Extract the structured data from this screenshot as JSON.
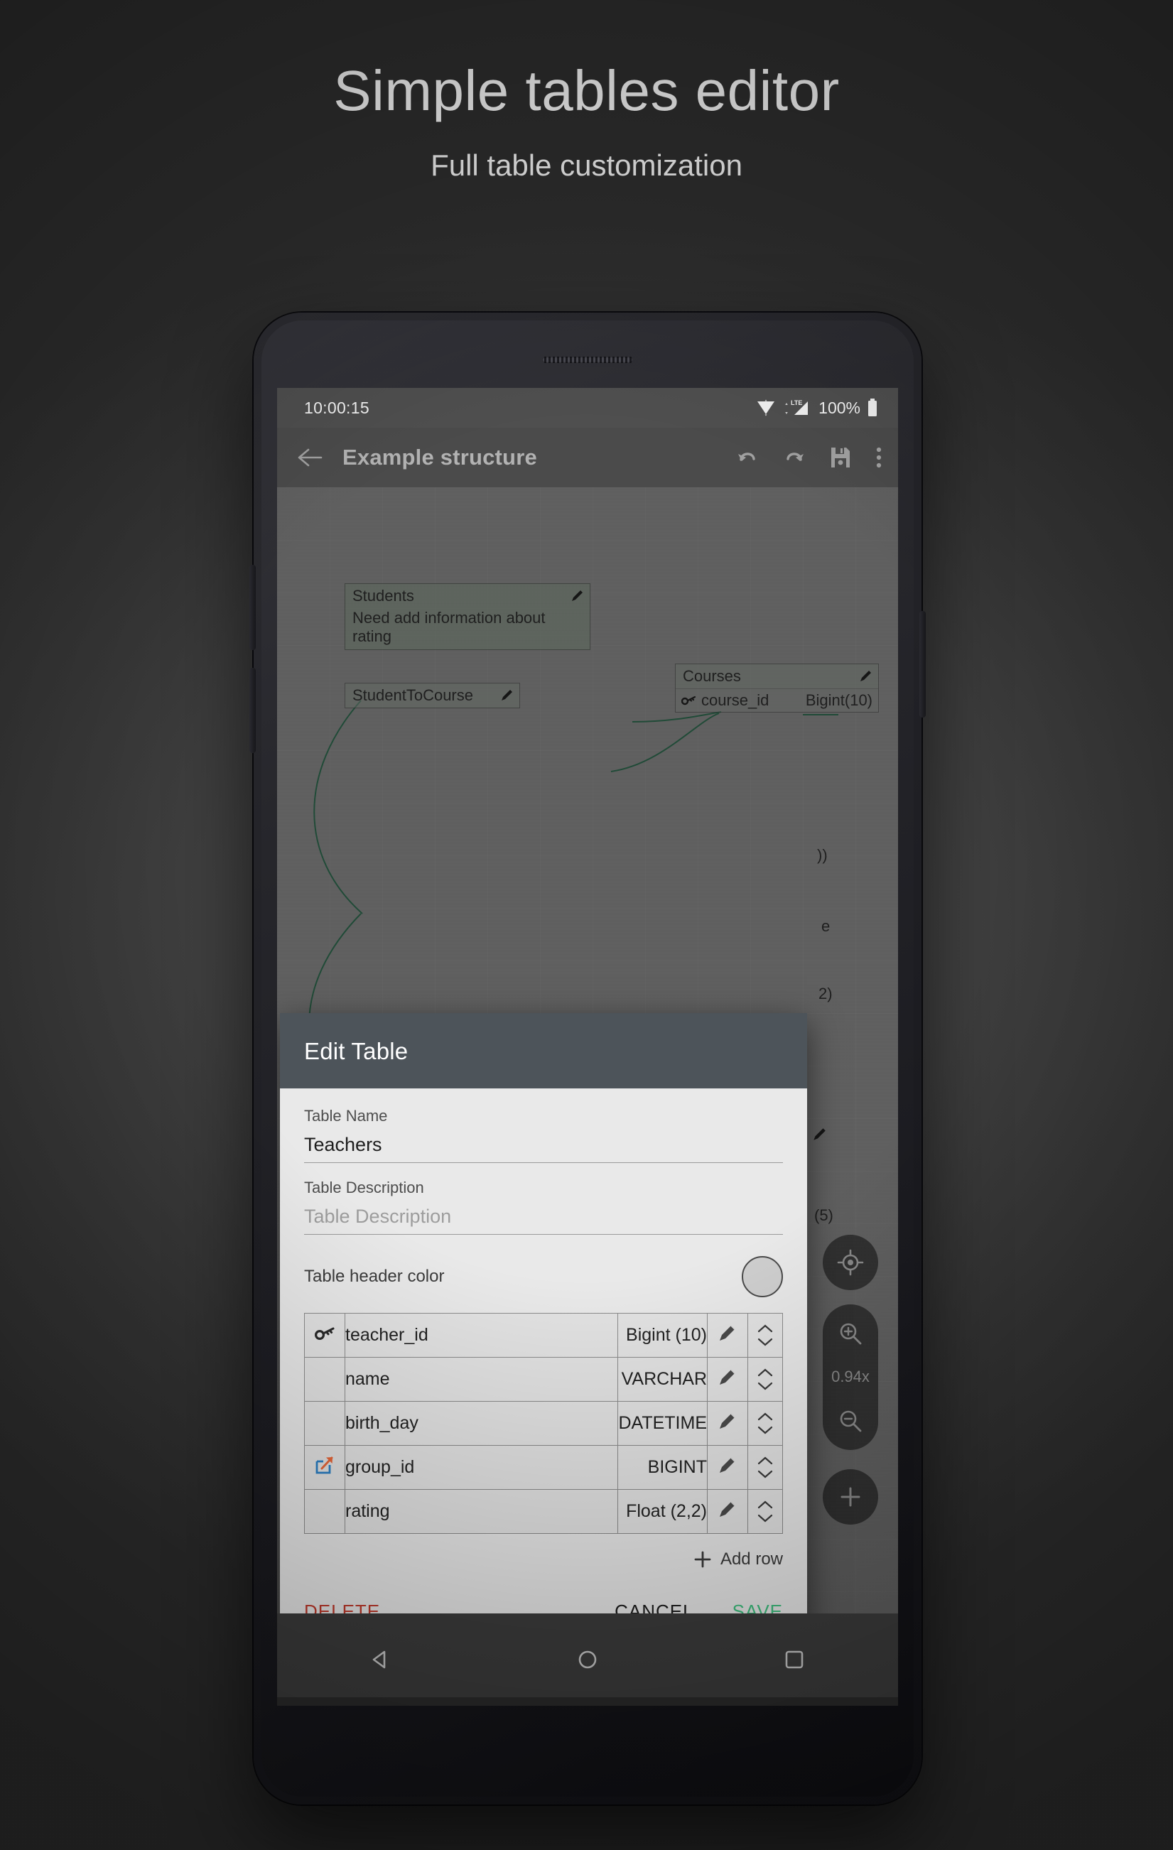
{
  "poster": {
    "title": "Simple tables editor",
    "subtitle": "Full table customization"
  },
  "colors": {
    "accent_save": "#3fbf7f",
    "accent_delete": "#c0392b",
    "dialog_header_bg": "#4d545a",
    "table_header_color_swatch": "#cfcfcf",
    "fk_icon_box": "#2b7fc4",
    "fk_icon_arrow": "#e8673a",
    "connector_line": "#2e6b4f"
  },
  "phone": {
    "status_bar": {
      "clock": "10:00:15",
      "wifi_icon": "wifi-icon",
      "signal_icon": "lte-signal-icon",
      "network_label": "LTE",
      "battery_percent": "100%",
      "battery_icon": "battery-full-icon"
    },
    "app_bar": {
      "back_icon": "back-arrow-icon",
      "title": "Example structure",
      "undo_icon": "undo-icon",
      "redo_icon": "redo-icon",
      "save_icon": "save-floppy-icon",
      "overflow_icon": "overflow-menu-icon"
    },
    "nav_bar": {
      "back": "triangle-back-icon",
      "home": "circle-home-icon",
      "recents": "square-recents-icon"
    }
  },
  "canvas": {
    "entities": [
      {
        "name": "Students",
        "description": "Need add information about rating",
        "edit_icon": "pencil-icon",
        "fields": []
      },
      {
        "name": "StudentToCourse",
        "edit_icon": "pencil-icon",
        "fields": []
      },
      {
        "name": "Courses",
        "edit_icon": "pencil-icon",
        "fields": [
          {
            "key_icon": "primary-key-icon",
            "name": "course_id",
            "type": "Bigint(10)"
          }
        ]
      }
    ],
    "hidden_fragments": [
      "))",
      "e",
      "2)",
      "(5)"
    ],
    "minimap": {
      "name": "minimap-overview"
    },
    "fabs": {
      "locate_icon": "locate-target-icon",
      "zoom_in_icon": "zoom-in-icon",
      "zoom_level": "0.94x",
      "zoom_out_icon": "zoom-out-icon",
      "add_icon": "plus-icon"
    }
  },
  "dialog": {
    "title": "Edit Table",
    "table_name_label": "Table Name",
    "table_name_value": "Teachers",
    "table_description_label": "Table Description",
    "table_description_placeholder": "Table Description",
    "header_color_label": "Table header color",
    "columns": [
      {
        "key_icon": "primary-key-icon",
        "name": "teacher_id",
        "type": "Bigint (10)",
        "edit_icon": "pencil-icon",
        "up_icon": "chevron-up-icon",
        "down_icon": "chevron-down-icon"
      },
      {
        "key_icon": "",
        "name": "name",
        "type": "VARCHAR",
        "edit_icon": "pencil-icon",
        "up_icon": "chevron-up-icon",
        "down_icon": "chevron-down-icon"
      },
      {
        "key_icon": "",
        "name": "birth_day",
        "type": "DATETIME",
        "edit_icon": "pencil-icon",
        "up_icon": "chevron-up-icon",
        "down_icon": "chevron-down-icon"
      },
      {
        "key_icon": "foreign-key-icon",
        "name": "group_id",
        "type": "BIGINT",
        "edit_icon": "pencil-icon",
        "up_icon": "chevron-up-icon",
        "down_icon": "chevron-down-icon"
      },
      {
        "key_icon": "",
        "name": "rating",
        "type": "Float (2,2)",
        "edit_icon": "pencil-icon",
        "up_icon": "chevron-up-icon",
        "down_icon": "chevron-down-icon"
      }
    ],
    "add_row_label": "Add row",
    "add_row_icon": "plus-icon",
    "delete_label": "DELETE",
    "cancel_label": "CANCEL",
    "save_label": "SAVE"
  }
}
